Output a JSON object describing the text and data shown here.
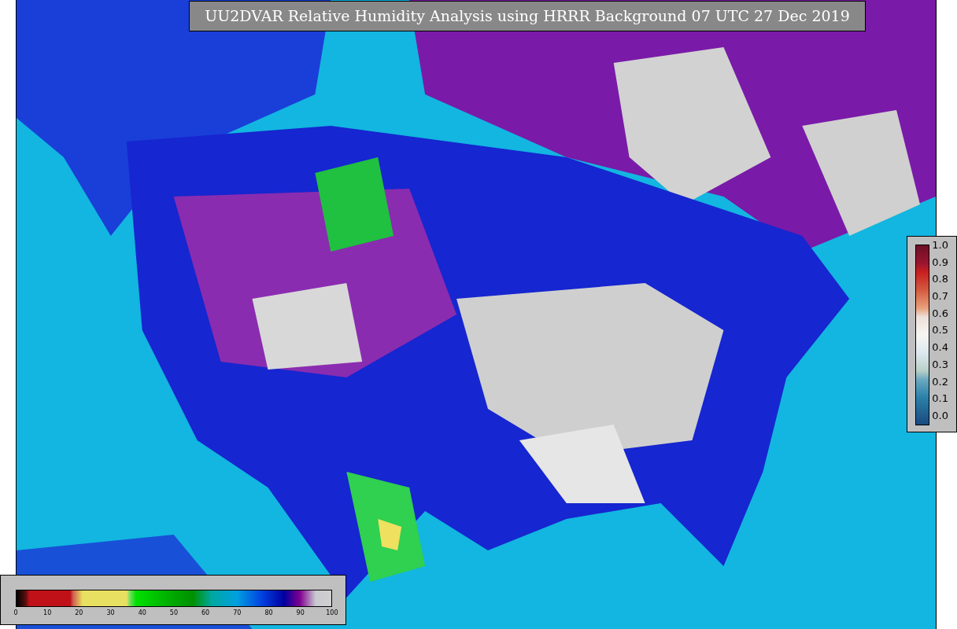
{
  "title": "UU2DVAR Relative Humidity Analysis using HRRR Background 07 UTC 27 Dec 2019",
  "right_colorbar": {
    "ticks": [
      "1.0",
      "0.9",
      "0.8",
      "0.7",
      "0.6",
      "0.5",
      "0.4",
      "0.3",
      "0.2",
      "0.1",
      "0.0"
    ]
  },
  "bottom_colorbar": {
    "ticks": [
      "0",
      "10",
      "20",
      "30",
      "40",
      "50",
      "60",
      "70",
      "80",
      "90",
      "100"
    ]
  }
}
